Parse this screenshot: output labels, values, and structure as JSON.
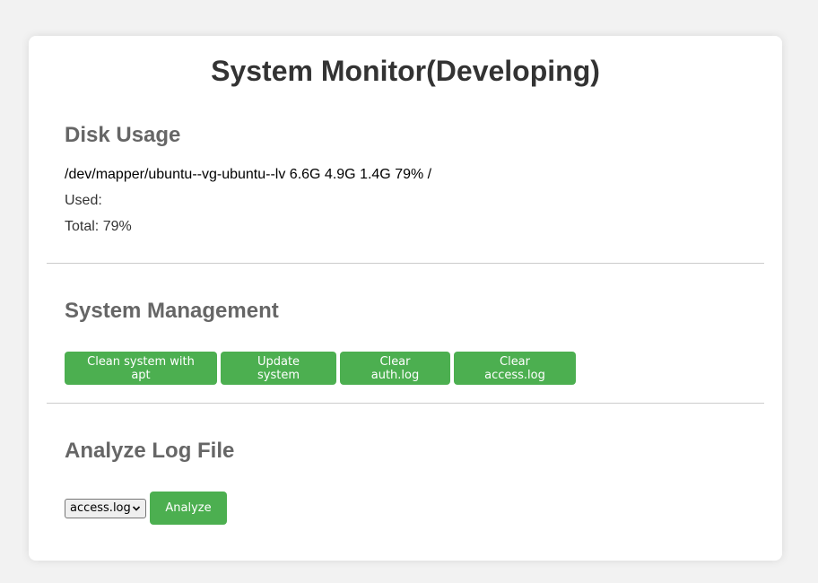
{
  "page": {
    "title": "System Monitor(Developing)"
  },
  "disk": {
    "heading": "Disk Usage",
    "device_line": "/dev/mapper/ubuntu--vg-ubuntu--lv 6.6G 4.9G 1.4G 79% /",
    "used_label": "Used:",
    "total_label": "Total: 79%"
  },
  "management": {
    "heading": "System Management",
    "buttons": [
      {
        "label": "Clean system with apt"
      },
      {
        "label": "Update system"
      },
      {
        "label": "Clear auth.log"
      },
      {
        "label": "Clear access.log"
      }
    ]
  },
  "analyze": {
    "heading": "Analyze Log File",
    "selected_log": "access.log",
    "button_label": "Analyze"
  },
  "colors": {
    "button_green": "#4caf50",
    "title_text": "#333333",
    "heading_text": "#666666",
    "background": "#f2f2f2"
  }
}
